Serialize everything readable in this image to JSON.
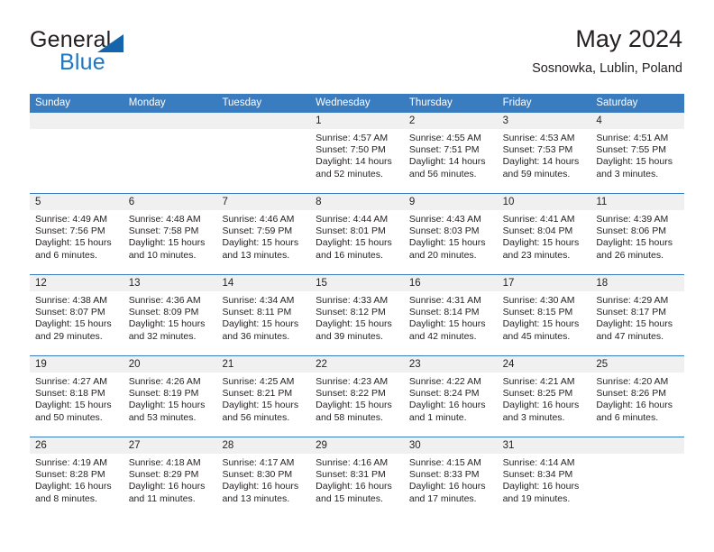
{
  "brand": {
    "name_part1": "General",
    "name_part2": "Blue"
  },
  "header": {
    "title": "May 2024",
    "subtitle": "Sosnowka, Lublin, Poland"
  },
  "calendar": {
    "weekdays": [
      "Sunday",
      "Monday",
      "Tuesday",
      "Wednesday",
      "Thursday",
      "Friday",
      "Saturday"
    ],
    "labels": {
      "sunrise": "Sunrise:",
      "sunset": "Sunset:",
      "daylight": "Daylight:"
    },
    "colors": {
      "header_blue": "#3a7cc0",
      "brand_blue": "#1f76c2",
      "day_band": "#f0f0f0",
      "text": "#231f20"
    },
    "weeks": [
      [
        {
          "day": "",
          "empty": true
        },
        {
          "day": "",
          "empty": true
        },
        {
          "day": "",
          "empty": true
        },
        {
          "day": "1",
          "sunrise": "Sunrise: 4:57 AM",
          "sunset": "Sunset: 7:50 PM",
          "daylight_line1": "Daylight: 14 hours",
          "daylight_line2": "and 52 minutes."
        },
        {
          "day": "2",
          "sunrise": "Sunrise: 4:55 AM",
          "sunset": "Sunset: 7:51 PM",
          "daylight_line1": "Daylight: 14 hours",
          "daylight_line2": "and 56 minutes."
        },
        {
          "day": "3",
          "sunrise": "Sunrise: 4:53 AM",
          "sunset": "Sunset: 7:53 PM",
          "daylight_line1": "Daylight: 14 hours",
          "daylight_line2": "and 59 minutes."
        },
        {
          "day": "4",
          "sunrise": "Sunrise: 4:51 AM",
          "sunset": "Sunset: 7:55 PM",
          "daylight_line1": "Daylight: 15 hours",
          "daylight_line2": "and 3 minutes."
        }
      ],
      [
        {
          "day": "5",
          "sunrise": "Sunrise: 4:49 AM",
          "sunset": "Sunset: 7:56 PM",
          "daylight_line1": "Daylight: 15 hours",
          "daylight_line2": "and 6 minutes."
        },
        {
          "day": "6",
          "sunrise": "Sunrise: 4:48 AM",
          "sunset": "Sunset: 7:58 PM",
          "daylight_line1": "Daylight: 15 hours",
          "daylight_line2": "and 10 minutes."
        },
        {
          "day": "7",
          "sunrise": "Sunrise: 4:46 AM",
          "sunset": "Sunset: 7:59 PM",
          "daylight_line1": "Daylight: 15 hours",
          "daylight_line2": "and 13 minutes."
        },
        {
          "day": "8",
          "sunrise": "Sunrise: 4:44 AM",
          "sunset": "Sunset: 8:01 PM",
          "daylight_line1": "Daylight: 15 hours",
          "daylight_line2": "and 16 minutes."
        },
        {
          "day": "9",
          "sunrise": "Sunrise: 4:43 AM",
          "sunset": "Sunset: 8:03 PM",
          "daylight_line1": "Daylight: 15 hours",
          "daylight_line2": "and 20 minutes."
        },
        {
          "day": "10",
          "sunrise": "Sunrise: 4:41 AM",
          "sunset": "Sunset: 8:04 PM",
          "daylight_line1": "Daylight: 15 hours",
          "daylight_line2": "and 23 minutes."
        },
        {
          "day": "11",
          "sunrise": "Sunrise: 4:39 AM",
          "sunset": "Sunset: 8:06 PM",
          "daylight_line1": "Daylight: 15 hours",
          "daylight_line2": "and 26 minutes."
        }
      ],
      [
        {
          "day": "12",
          "sunrise": "Sunrise: 4:38 AM",
          "sunset": "Sunset: 8:07 PM",
          "daylight_line1": "Daylight: 15 hours",
          "daylight_line2": "and 29 minutes."
        },
        {
          "day": "13",
          "sunrise": "Sunrise: 4:36 AM",
          "sunset": "Sunset: 8:09 PM",
          "daylight_line1": "Daylight: 15 hours",
          "daylight_line2": "and 32 minutes."
        },
        {
          "day": "14",
          "sunrise": "Sunrise: 4:34 AM",
          "sunset": "Sunset: 8:11 PM",
          "daylight_line1": "Daylight: 15 hours",
          "daylight_line2": "and 36 minutes."
        },
        {
          "day": "15",
          "sunrise": "Sunrise: 4:33 AM",
          "sunset": "Sunset: 8:12 PM",
          "daylight_line1": "Daylight: 15 hours",
          "daylight_line2": "and 39 minutes."
        },
        {
          "day": "16",
          "sunrise": "Sunrise: 4:31 AM",
          "sunset": "Sunset: 8:14 PM",
          "daylight_line1": "Daylight: 15 hours",
          "daylight_line2": "and 42 minutes."
        },
        {
          "day": "17",
          "sunrise": "Sunrise: 4:30 AM",
          "sunset": "Sunset: 8:15 PM",
          "daylight_line1": "Daylight: 15 hours",
          "daylight_line2": "and 45 minutes."
        },
        {
          "day": "18",
          "sunrise": "Sunrise: 4:29 AM",
          "sunset": "Sunset: 8:17 PM",
          "daylight_line1": "Daylight: 15 hours",
          "daylight_line2": "and 47 minutes."
        }
      ],
      [
        {
          "day": "19",
          "sunrise": "Sunrise: 4:27 AM",
          "sunset": "Sunset: 8:18 PM",
          "daylight_line1": "Daylight: 15 hours",
          "daylight_line2": "and 50 minutes."
        },
        {
          "day": "20",
          "sunrise": "Sunrise: 4:26 AM",
          "sunset": "Sunset: 8:19 PM",
          "daylight_line1": "Daylight: 15 hours",
          "daylight_line2": "and 53 minutes."
        },
        {
          "day": "21",
          "sunrise": "Sunrise: 4:25 AM",
          "sunset": "Sunset: 8:21 PM",
          "daylight_line1": "Daylight: 15 hours",
          "daylight_line2": "and 56 minutes."
        },
        {
          "day": "22",
          "sunrise": "Sunrise: 4:23 AM",
          "sunset": "Sunset: 8:22 PM",
          "daylight_line1": "Daylight: 15 hours",
          "daylight_line2": "and 58 minutes."
        },
        {
          "day": "23",
          "sunrise": "Sunrise: 4:22 AM",
          "sunset": "Sunset: 8:24 PM",
          "daylight_line1": "Daylight: 16 hours",
          "daylight_line2": "and 1 minute."
        },
        {
          "day": "24",
          "sunrise": "Sunrise: 4:21 AM",
          "sunset": "Sunset: 8:25 PM",
          "daylight_line1": "Daylight: 16 hours",
          "daylight_line2": "and 3 minutes."
        },
        {
          "day": "25",
          "sunrise": "Sunrise: 4:20 AM",
          "sunset": "Sunset: 8:26 PM",
          "daylight_line1": "Daylight: 16 hours",
          "daylight_line2": "and 6 minutes."
        }
      ],
      [
        {
          "day": "26",
          "sunrise": "Sunrise: 4:19 AM",
          "sunset": "Sunset: 8:28 PM",
          "daylight_line1": "Daylight: 16 hours",
          "daylight_line2": "and 8 minutes."
        },
        {
          "day": "27",
          "sunrise": "Sunrise: 4:18 AM",
          "sunset": "Sunset: 8:29 PM",
          "daylight_line1": "Daylight: 16 hours",
          "daylight_line2": "and 11 minutes."
        },
        {
          "day": "28",
          "sunrise": "Sunrise: 4:17 AM",
          "sunset": "Sunset: 8:30 PM",
          "daylight_line1": "Daylight: 16 hours",
          "daylight_line2": "and 13 minutes."
        },
        {
          "day": "29",
          "sunrise": "Sunrise: 4:16 AM",
          "sunset": "Sunset: 8:31 PM",
          "daylight_line1": "Daylight: 16 hours",
          "daylight_line2": "and 15 minutes."
        },
        {
          "day": "30",
          "sunrise": "Sunrise: 4:15 AM",
          "sunset": "Sunset: 8:33 PM",
          "daylight_line1": "Daylight: 16 hours",
          "daylight_line2": "and 17 minutes."
        },
        {
          "day": "31",
          "sunrise": "Sunrise: 4:14 AM",
          "sunset": "Sunset: 8:34 PM",
          "daylight_line1": "Daylight: 16 hours",
          "daylight_line2": "and 19 minutes."
        },
        {
          "day": "",
          "empty": true
        }
      ]
    ]
  }
}
